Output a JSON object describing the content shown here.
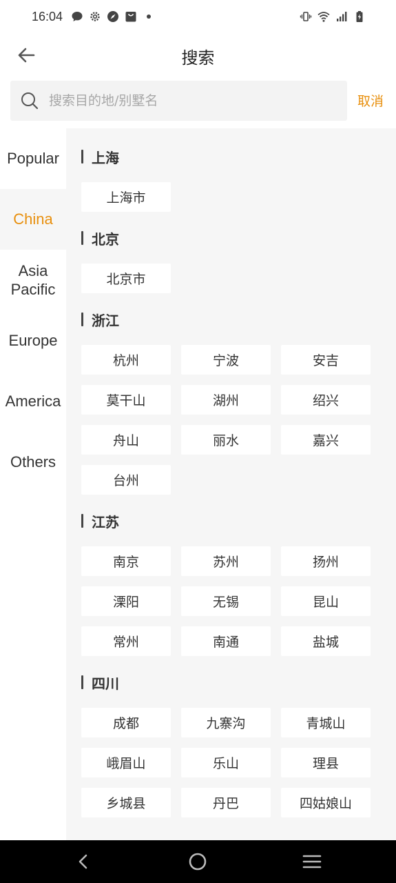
{
  "status_bar": {
    "time": "16:04"
  },
  "header": {
    "title": "搜索"
  },
  "search": {
    "placeholder": "搜索目的地/别墅名",
    "value": "",
    "cancel_label": "取消"
  },
  "colors": {
    "accent": "#e8900f",
    "content_bg": "#f6f6f6"
  },
  "sidebar": {
    "items": [
      {
        "label": "Popular",
        "active": false
      },
      {
        "label": "China",
        "active": true
      },
      {
        "label": "Asia Pacific",
        "active": false
      },
      {
        "label": "Europe",
        "active": false
      },
      {
        "label": "America",
        "active": false
      },
      {
        "label": "Others",
        "active": false
      }
    ]
  },
  "sections": [
    {
      "title": "上海",
      "cities": [
        "上海市"
      ]
    },
    {
      "title": "北京",
      "cities": [
        "北京市"
      ]
    },
    {
      "title": "浙江",
      "cities": [
        "杭州",
        "宁波",
        "安吉",
        "莫干山",
        "湖州",
        "绍兴",
        "舟山",
        "丽水",
        "嘉兴",
        "台州"
      ]
    },
    {
      "title": "江苏",
      "cities": [
        "南京",
        "苏州",
        "扬州",
        "溧阳",
        "无锡",
        "昆山",
        "常州",
        "南通",
        "盐城"
      ]
    },
    {
      "title": "四川",
      "cities": [
        "成都",
        "九寨沟",
        "青城山",
        "峨眉山",
        "乐山",
        "理县",
        "乡城县",
        "丹巴",
        "四姑娘山"
      ]
    }
  ]
}
